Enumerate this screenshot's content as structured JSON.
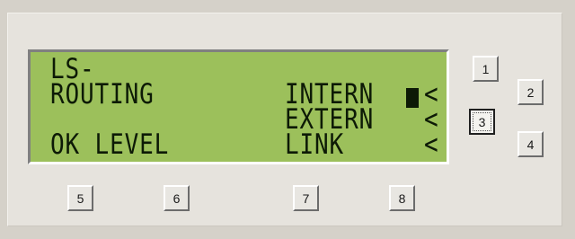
{
  "display": {
    "line1": "LS-",
    "line2_left": "ROUTING",
    "line2_right": "INTERN",
    "line3_right": "EXTERN",
    "line4_left": "OK LEVEL",
    "line4_right": "LINK",
    "arrow": "<"
  },
  "side_buttons": {
    "b1": "1",
    "b2": "2",
    "b3": "3",
    "b4": "4"
  },
  "bottom_buttons": {
    "b5": "5",
    "b6": "6",
    "b7": "7",
    "b8": "8"
  }
}
